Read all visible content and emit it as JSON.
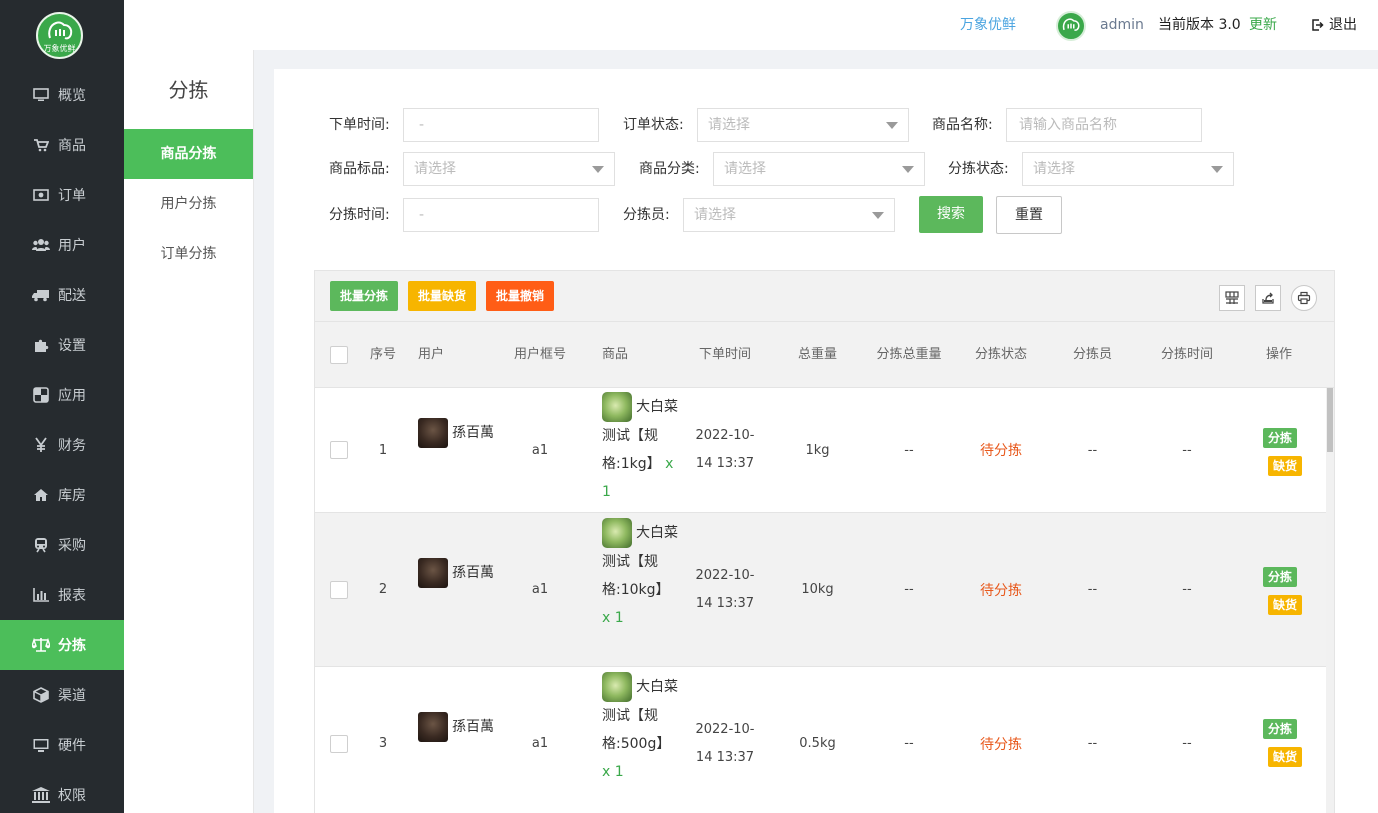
{
  "app": {
    "logo_text": "万象优鲜",
    "brand_link": "万象优鲜",
    "user": "admin",
    "version_label": "当前版本 3.0",
    "update_label": "更新",
    "logout_label": "退出"
  },
  "sidebar": {
    "items": [
      {
        "label": "概览",
        "icon": "monitor-icon"
      },
      {
        "label": "商品",
        "icon": "cart-icon"
      },
      {
        "label": "订单",
        "icon": "money-icon"
      },
      {
        "label": "用户",
        "icon": "users-icon"
      },
      {
        "label": "配送",
        "icon": "truck-icon"
      },
      {
        "label": "设置",
        "icon": "puzzle-icon"
      },
      {
        "label": "应用",
        "icon": "apps-icon"
      },
      {
        "label": "财务",
        "icon": "yen-icon"
      },
      {
        "label": "库房",
        "icon": "home-icon"
      },
      {
        "label": "采购",
        "icon": "train-icon"
      },
      {
        "label": "报表",
        "icon": "bar-chart-icon"
      },
      {
        "label": "分拣",
        "icon": "scale-icon",
        "active": true
      },
      {
        "label": "渠道",
        "icon": "cube-icon"
      },
      {
        "label": "硬件",
        "icon": "desktop-icon"
      },
      {
        "label": "权限",
        "icon": "bank-icon"
      }
    ]
  },
  "subnav": {
    "title": "分拣",
    "items": [
      {
        "label": "商品分拣",
        "active": true
      },
      {
        "label": "用户分拣"
      },
      {
        "label": "订单分拣"
      }
    ]
  },
  "filters": {
    "order_time_label": "下单时间:",
    "order_time_value": "-",
    "order_status_label": "订单状态:",
    "order_status_placeholder": "请选择",
    "goods_name_label": "商品名称:",
    "goods_name_placeholder": "请输入商品名称",
    "goods_tag_label": "商品标品:",
    "goods_tag_placeholder": "请选择",
    "goods_category_label": "商品分类:",
    "goods_category_placeholder": "请选择",
    "sort_status_label": "分拣状态:",
    "sort_status_placeholder": "请选择",
    "sort_time_label": "分拣时间:",
    "sort_time_value": "-",
    "sorter_label": "分拣员:",
    "sorter_placeholder": "请选择",
    "search_label": "搜索",
    "reset_label": "重置"
  },
  "toolbar": {
    "batch_sort": "批量分拣",
    "batch_short": "批量缺货",
    "batch_cancel": "批量撤销"
  },
  "table": {
    "columns": [
      "序号",
      "用户",
      "用户框号",
      "商品",
      "下单时间",
      "总重量",
      "分拣总重量",
      "分拣状态",
      "分拣员",
      "分拣时间",
      "操作"
    ],
    "rows": [
      {
        "index": "1",
        "user": "孫百萬",
        "box": "a1",
        "goods": "大白菜 测试【规格:1kg】",
        "qty": "x 1",
        "order_time": "2022-10-14 13:37",
        "weight": "1kg",
        "sorted_weight": "--",
        "status": "待分拣",
        "sorter": "--",
        "sort_time": "--",
        "action_sort": "分拣",
        "action_short": "缺货"
      },
      {
        "index": "2",
        "user": "孫百萬",
        "box": "a1",
        "goods": "大白菜 测试【规格:10kg】",
        "qty": "x 1",
        "order_time": "2022-10-14 13:37",
        "weight": "10kg",
        "sorted_weight": "--",
        "status": "待分拣",
        "sorter": "--",
        "sort_time": "--",
        "action_sort": "分拣",
        "action_short": "缺货"
      },
      {
        "index": "3",
        "user": "孫百萬",
        "box": "a1",
        "goods": "大白菜 测试【规格:500g】",
        "qty": "x 1",
        "order_time": "2022-10-14 13:37",
        "weight": "0.5kg",
        "sorted_weight": "--",
        "status": "待分拣",
        "sorter": "--",
        "sort_time": "--",
        "action_sort": "分拣",
        "action_short": "缺货"
      }
    ]
  },
  "colors": {
    "accent": "#4cbe5a",
    "sidebar_bg": "#262b2f",
    "status_pending": "#e85a1e",
    "warning": "#f7b500",
    "danger": "#ff5d16"
  }
}
